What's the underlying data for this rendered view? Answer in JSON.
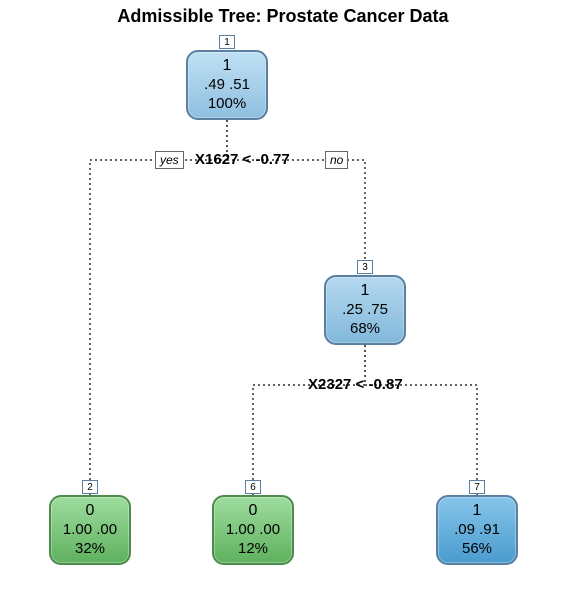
{
  "chart_data": {
    "type": "tree",
    "title": "Admissible Tree: Prostate Cancer Data",
    "nodes": [
      {
        "id": 1,
        "predicted_class": 1,
        "probs": [
          0.49,
          0.51
        ],
        "pct": "100%"
      },
      {
        "id": 3,
        "predicted_class": 1,
        "probs": [
          0.25,
          0.75
        ],
        "pct": "68%"
      },
      {
        "id": 2,
        "predicted_class": 0,
        "probs": [
          1.0,
          0.0
        ],
        "pct": "32%"
      },
      {
        "id": 6,
        "predicted_class": 0,
        "probs": [
          1.0,
          0.0
        ],
        "pct": "12%"
      },
      {
        "id": 7,
        "predicted_class": 1,
        "probs": [
          0.09,
          0.91
        ],
        "pct": "56%"
      }
    ],
    "splits": [
      {
        "parent": 1,
        "condition": "X1627 < -0.77",
        "yes_child": 2,
        "no_child": 3
      },
      {
        "parent": 3,
        "condition": "X2327 < -0.87",
        "yes_child": 6,
        "no_child": 7
      }
    ]
  },
  "title": "Admissible Tree: Prostate Cancer Data",
  "nodes": {
    "n1": {
      "id": "1",
      "class": "1",
      "probs": ".49  .51",
      "pct": "100%"
    },
    "n3": {
      "id": "3",
      "class": "1",
      "probs": ".25  .75",
      "pct": "68%"
    },
    "n2": {
      "id": "2",
      "class": "0",
      "probs": "1.00  .00",
      "pct": "32%"
    },
    "n6": {
      "id": "6",
      "class": "0",
      "probs": "1.00  .00",
      "pct": "12%"
    },
    "n7": {
      "id": "7",
      "class": "1",
      "probs": ".09  .91",
      "pct": "56%"
    }
  },
  "splits": {
    "s1": {
      "condition": "X1627 < -0.77",
      "yes": "yes",
      "no": "no"
    },
    "s2": {
      "condition": "X2327 < -0.87"
    }
  },
  "colors": {
    "root": "#a9d3ee",
    "mid": "#9ec8e4",
    "leaf_green": "#7ac47a",
    "leaf_blue": "#5ca9d6"
  }
}
